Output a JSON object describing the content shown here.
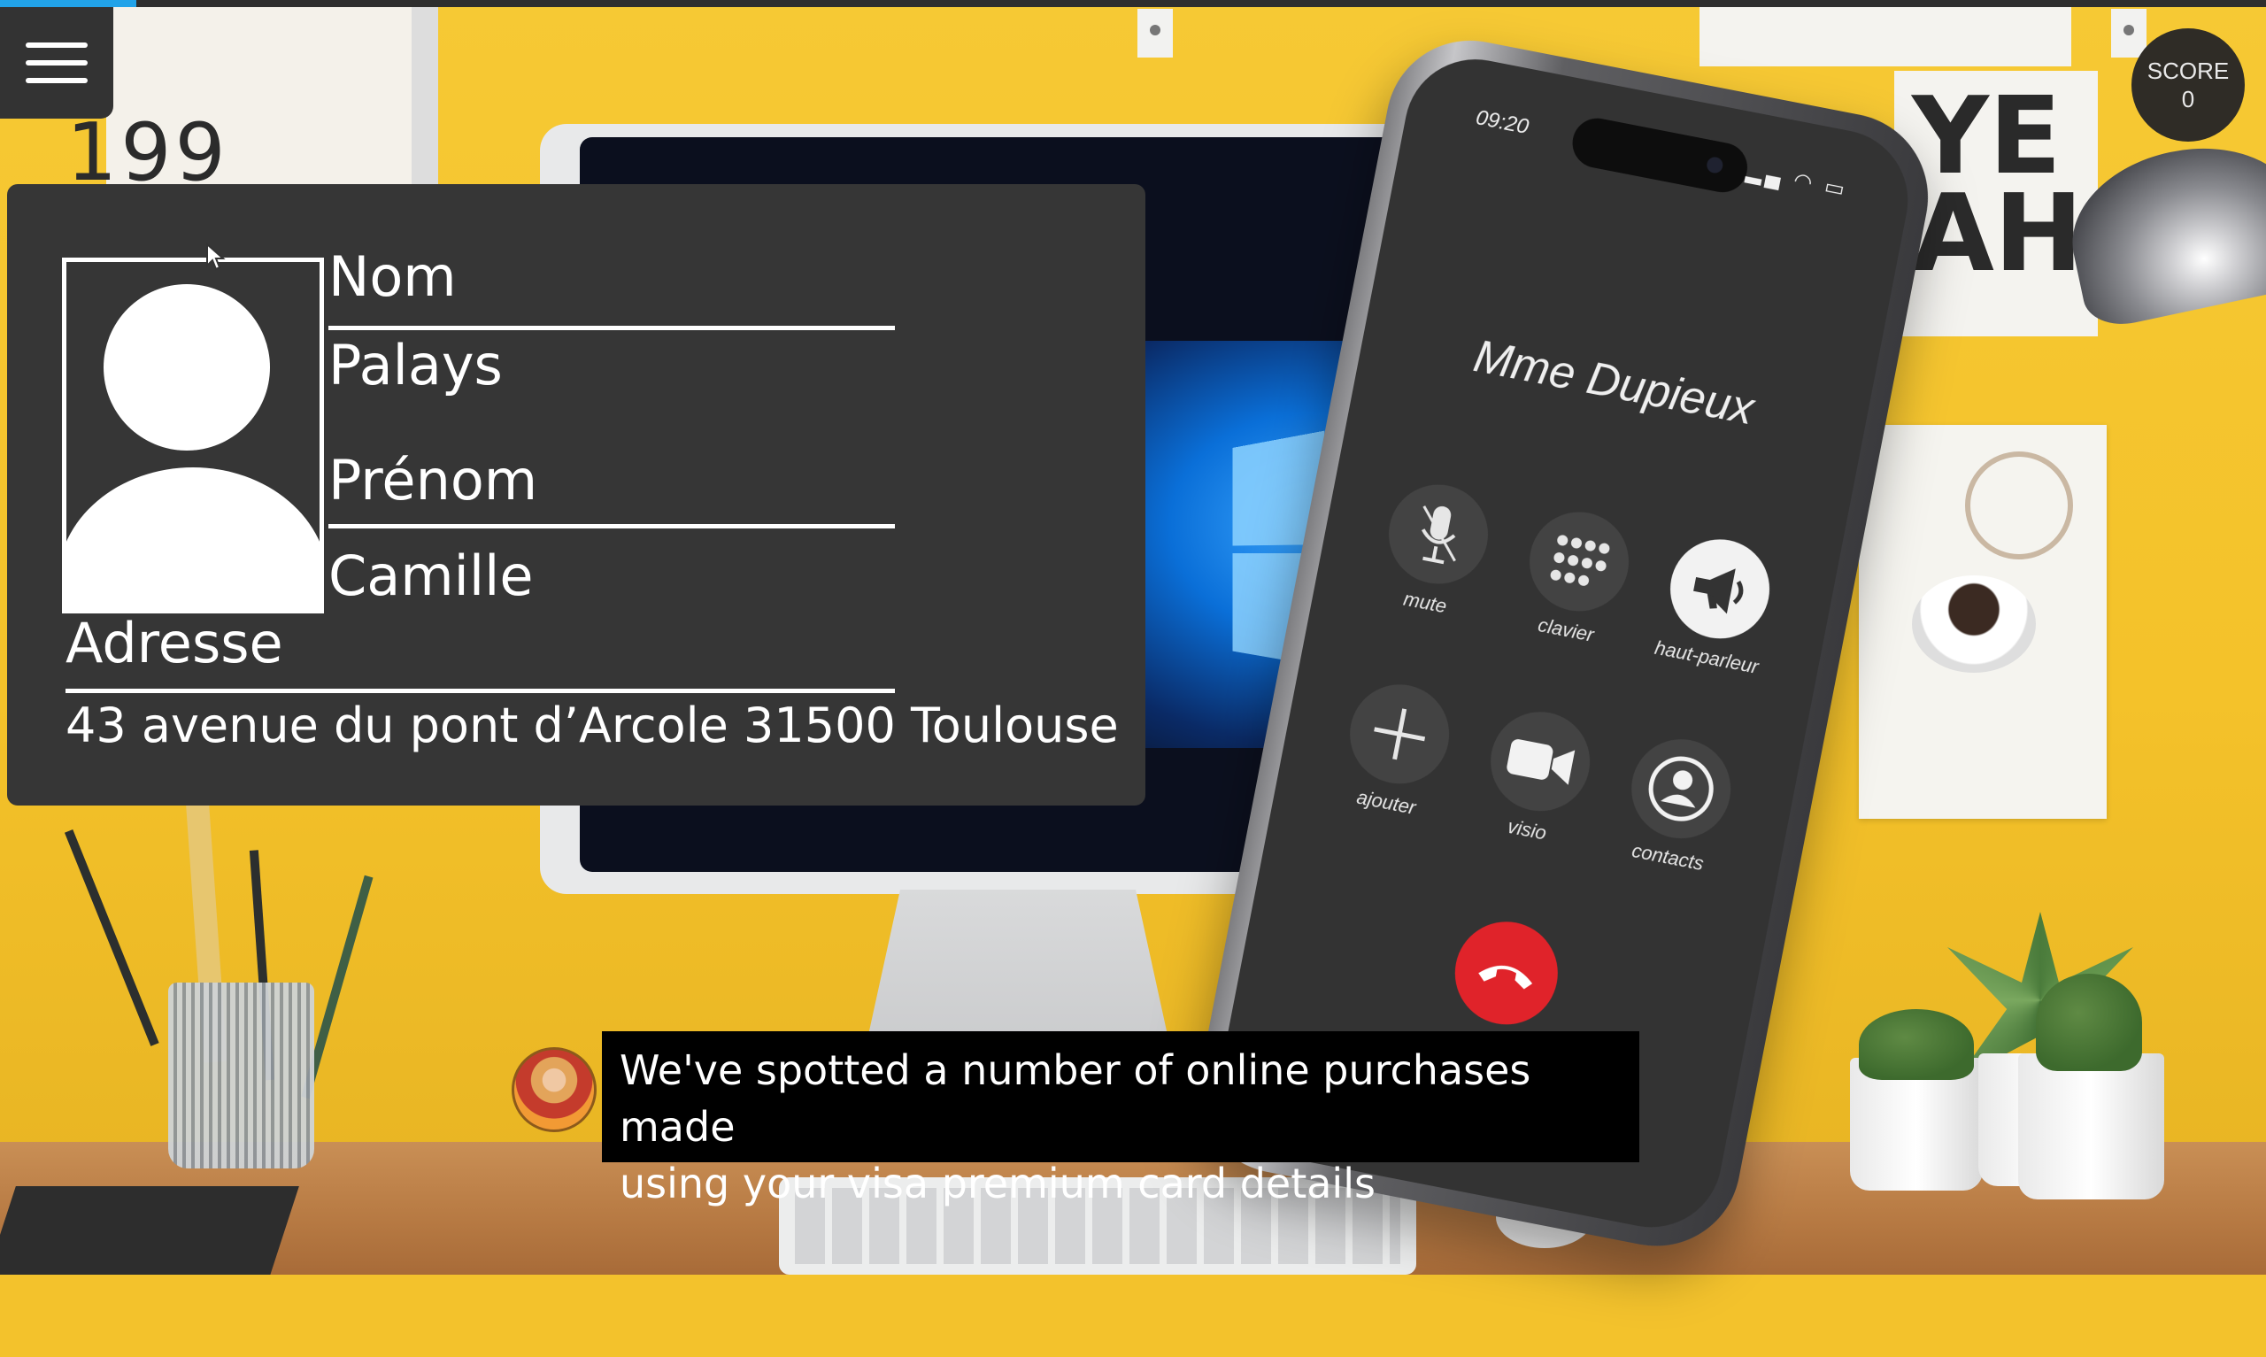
{
  "top_bar": {
    "progress": 0.06
  },
  "menu": {
    "icon": "hamburger-icon"
  },
  "score": {
    "label": "SCORE",
    "value": "0"
  },
  "id_card": {
    "nom_label": "Nom",
    "nom_value": "Palays",
    "prenom_label": "Prénom",
    "prenom_value": "Camille",
    "adresse_label": "Adresse",
    "adresse_value": "43 avenue du pont d’Arcole 31500 Toulouse"
  },
  "phone": {
    "time": "09:20",
    "caller": "Mme Dupieux",
    "buttons": [
      {
        "label": "mute",
        "icon": "microphone-icon"
      },
      {
        "label": "clavier",
        "icon": "keypad-icon"
      },
      {
        "label": "haut-parleur",
        "icon": "speaker-icon"
      },
      {
        "label": "ajouter",
        "icon": "plus-icon"
      },
      {
        "label": "visio",
        "icon": "video-camera-icon"
      },
      {
        "label": "contacts",
        "icon": "contact-icon"
      }
    ],
    "hangup_icon": "hang-up-icon"
  },
  "subtitle": {
    "line1": "We've spotted a number of online purchases made",
    "line2": "using your visa premium card details"
  },
  "background_text": {
    "wall_digits": "199",
    "poster": "YE AH"
  },
  "colors": {
    "wall": "#f4c22a",
    "card_bg": "#363636",
    "hangup": "#e0232a",
    "progress": "#22a3e9"
  }
}
